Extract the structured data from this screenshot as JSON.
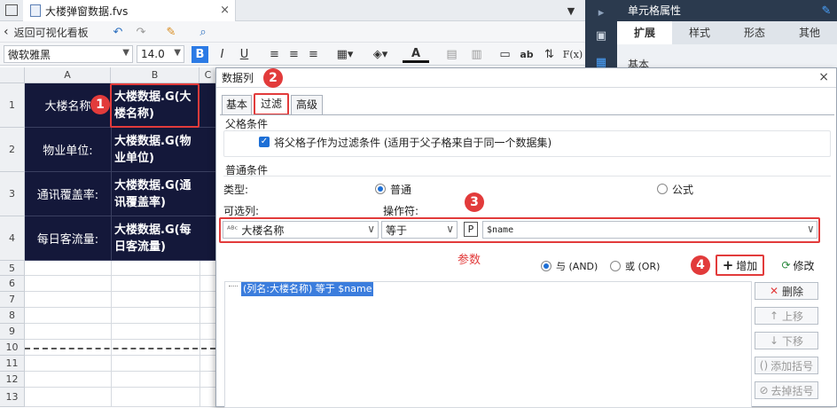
{
  "tabbar": {
    "file_name": "大楼弹窗数据.fvs",
    "close": "×"
  },
  "toolbar": {
    "back_label": "返回可视化看板",
    "font_name": "微软雅黑",
    "font_size": "14.0",
    "bold": "B",
    "italic": "I",
    "underline": "U",
    "text_color_letter": "A",
    "abc": "ab",
    "fx": "F(x)"
  },
  "sheet": {
    "columns": [
      "A",
      "B",
      "C"
    ],
    "rows": [
      {
        "num": "1",
        "a": "大楼名称",
        "b": "大楼数据.G(大楼名称)"
      },
      {
        "num": "2",
        "a": "物业单位:",
        "b": "大楼数据.G(物业单位)"
      },
      {
        "num": "3",
        "a": "通讯覆盖率:",
        "b": "大楼数据.G(通讯覆盖率)"
      },
      {
        "num": "4",
        "a": "每日客流量:",
        "b": "大楼数据.G(每日客流量)"
      }
    ],
    "empty_rows": [
      "5",
      "6",
      "7",
      "8",
      "9",
      "10",
      "11",
      "12",
      "13"
    ]
  },
  "right_panel": {
    "title": "单元格属性",
    "tabs": [
      "扩展",
      "样式",
      "形态",
      "其他"
    ],
    "section": "基本"
  },
  "dialog": {
    "title": "数据列",
    "close": "×",
    "tabs": [
      "基本",
      "过滤",
      "高级"
    ],
    "parent_group": "父格条件",
    "parent_checkbox_label": "将父格子作为过滤条件 (适用于父子格来自于同一个数据集)",
    "normal_group": "普通条件",
    "type_label": "类型:",
    "type_normal": "普通",
    "type_formula": "公式",
    "column_label": "可选列:",
    "operator_label": "操作符:",
    "column_value": "大楼名称",
    "operator_value": "等于",
    "param_value": "$name",
    "param_annotation": "参数",
    "and_label": "与 (AND)",
    "or_label": "或 (OR)",
    "add_button": "增加",
    "modify_button": "修改",
    "condition_item": "(列名:大楼名称) 等于 $name",
    "side_buttons": [
      "删除",
      "上移",
      "下移",
      "添加括号",
      "去掉括号"
    ]
  },
  "badges": [
    "1",
    "2",
    "3",
    "4"
  ],
  "colors": {
    "dark_cell": "#14183a",
    "accent": "#1d6fd6",
    "annotation": "#e23b3b"
  }
}
